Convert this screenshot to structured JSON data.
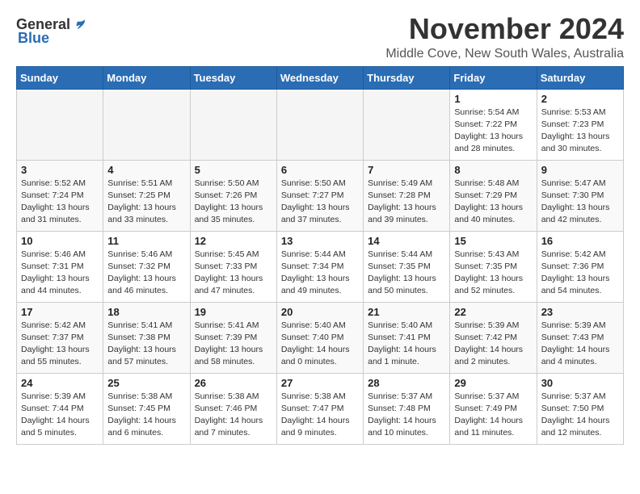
{
  "header": {
    "logo_general": "General",
    "logo_blue": "Blue",
    "month": "November 2024",
    "location": "Middle Cove, New South Wales, Australia"
  },
  "days_of_week": [
    "Sunday",
    "Monday",
    "Tuesday",
    "Wednesday",
    "Thursday",
    "Friday",
    "Saturday"
  ],
  "weeks": [
    [
      {
        "day": "",
        "info": ""
      },
      {
        "day": "",
        "info": ""
      },
      {
        "day": "",
        "info": ""
      },
      {
        "day": "",
        "info": ""
      },
      {
        "day": "",
        "info": ""
      },
      {
        "day": "1",
        "info": "Sunrise: 5:54 AM\nSunset: 7:22 PM\nDaylight: 13 hours\nand 28 minutes."
      },
      {
        "day": "2",
        "info": "Sunrise: 5:53 AM\nSunset: 7:23 PM\nDaylight: 13 hours\nand 30 minutes."
      }
    ],
    [
      {
        "day": "3",
        "info": "Sunrise: 5:52 AM\nSunset: 7:24 PM\nDaylight: 13 hours\nand 31 minutes."
      },
      {
        "day": "4",
        "info": "Sunrise: 5:51 AM\nSunset: 7:25 PM\nDaylight: 13 hours\nand 33 minutes."
      },
      {
        "day": "5",
        "info": "Sunrise: 5:50 AM\nSunset: 7:26 PM\nDaylight: 13 hours\nand 35 minutes."
      },
      {
        "day": "6",
        "info": "Sunrise: 5:50 AM\nSunset: 7:27 PM\nDaylight: 13 hours\nand 37 minutes."
      },
      {
        "day": "7",
        "info": "Sunrise: 5:49 AM\nSunset: 7:28 PM\nDaylight: 13 hours\nand 39 minutes."
      },
      {
        "day": "8",
        "info": "Sunrise: 5:48 AM\nSunset: 7:29 PM\nDaylight: 13 hours\nand 40 minutes."
      },
      {
        "day": "9",
        "info": "Sunrise: 5:47 AM\nSunset: 7:30 PM\nDaylight: 13 hours\nand 42 minutes."
      }
    ],
    [
      {
        "day": "10",
        "info": "Sunrise: 5:46 AM\nSunset: 7:31 PM\nDaylight: 13 hours\nand 44 minutes."
      },
      {
        "day": "11",
        "info": "Sunrise: 5:46 AM\nSunset: 7:32 PM\nDaylight: 13 hours\nand 46 minutes."
      },
      {
        "day": "12",
        "info": "Sunrise: 5:45 AM\nSunset: 7:33 PM\nDaylight: 13 hours\nand 47 minutes."
      },
      {
        "day": "13",
        "info": "Sunrise: 5:44 AM\nSunset: 7:34 PM\nDaylight: 13 hours\nand 49 minutes."
      },
      {
        "day": "14",
        "info": "Sunrise: 5:44 AM\nSunset: 7:35 PM\nDaylight: 13 hours\nand 50 minutes."
      },
      {
        "day": "15",
        "info": "Sunrise: 5:43 AM\nSunset: 7:35 PM\nDaylight: 13 hours\nand 52 minutes."
      },
      {
        "day": "16",
        "info": "Sunrise: 5:42 AM\nSunset: 7:36 PM\nDaylight: 13 hours\nand 54 minutes."
      }
    ],
    [
      {
        "day": "17",
        "info": "Sunrise: 5:42 AM\nSunset: 7:37 PM\nDaylight: 13 hours\nand 55 minutes."
      },
      {
        "day": "18",
        "info": "Sunrise: 5:41 AM\nSunset: 7:38 PM\nDaylight: 13 hours\nand 57 minutes."
      },
      {
        "day": "19",
        "info": "Sunrise: 5:41 AM\nSunset: 7:39 PM\nDaylight: 13 hours\nand 58 minutes."
      },
      {
        "day": "20",
        "info": "Sunrise: 5:40 AM\nSunset: 7:40 PM\nDaylight: 14 hours\nand 0 minutes."
      },
      {
        "day": "21",
        "info": "Sunrise: 5:40 AM\nSunset: 7:41 PM\nDaylight: 14 hours\nand 1 minute."
      },
      {
        "day": "22",
        "info": "Sunrise: 5:39 AM\nSunset: 7:42 PM\nDaylight: 14 hours\nand 2 minutes."
      },
      {
        "day": "23",
        "info": "Sunrise: 5:39 AM\nSunset: 7:43 PM\nDaylight: 14 hours\nand 4 minutes."
      }
    ],
    [
      {
        "day": "24",
        "info": "Sunrise: 5:39 AM\nSunset: 7:44 PM\nDaylight: 14 hours\nand 5 minutes."
      },
      {
        "day": "25",
        "info": "Sunrise: 5:38 AM\nSunset: 7:45 PM\nDaylight: 14 hours\nand 6 minutes."
      },
      {
        "day": "26",
        "info": "Sunrise: 5:38 AM\nSunset: 7:46 PM\nDaylight: 14 hours\nand 7 minutes."
      },
      {
        "day": "27",
        "info": "Sunrise: 5:38 AM\nSunset: 7:47 PM\nDaylight: 14 hours\nand 9 minutes."
      },
      {
        "day": "28",
        "info": "Sunrise: 5:37 AM\nSunset: 7:48 PM\nDaylight: 14 hours\nand 10 minutes."
      },
      {
        "day": "29",
        "info": "Sunrise: 5:37 AM\nSunset: 7:49 PM\nDaylight: 14 hours\nand 11 minutes."
      },
      {
        "day": "30",
        "info": "Sunrise: 5:37 AM\nSunset: 7:50 PM\nDaylight: 14 hours\nand 12 minutes."
      }
    ]
  ]
}
